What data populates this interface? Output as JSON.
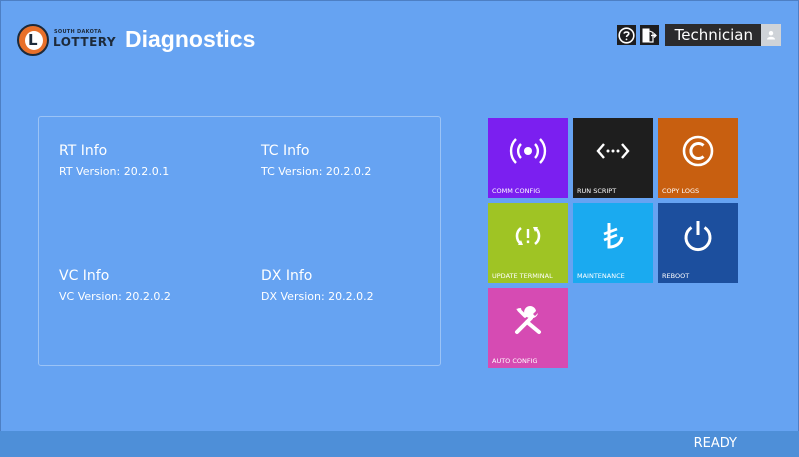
{
  "header": {
    "logo_small_text": "SOUTH DAKOTA",
    "logo_big_text": "LOTTERY",
    "logo_letter": "L",
    "title": "Diagnostics",
    "help_icon": "question-circle-icon",
    "logout_icon": "exit-door-icon",
    "user_name": "Technician",
    "user_icon": "user-icon"
  },
  "info": [
    {
      "title": "RT Info",
      "version": "RT Version: 20.2.0.1"
    },
    {
      "title": "TC Info",
      "version": "TC Version: 20.2.0.2"
    },
    {
      "title": "VC Info",
      "version": "VC Version: 20.2.0.2"
    },
    {
      "title": "DX Info",
      "version": "DX Version: 20.2.0.2"
    }
  ],
  "tiles": [
    {
      "label": "COMM CONFIG",
      "icon": "broadcast-icon",
      "color": "#7b1ff0"
    },
    {
      "label": "RUN SCRIPT",
      "icon": "code-arrows-icon",
      "color": "#1e1e1e"
    },
    {
      "label": "COPY LOGS",
      "icon": "copyright-icon",
      "color": "#c85f10"
    },
    {
      "label": "UPDATE TERMINAL",
      "icon": "sync-icon",
      "color": "#9fc424"
    },
    {
      "label": "MAINTENANCE",
      "icon": "lira-icon",
      "color": "#1aaaf0"
    },
    {
      "label": "REBOOT",
      "icon": "power-icon",
      "color": "#1c4f9e"
    },
    {
      "label": "AUTO CONFIG",
      "icon": "tools-icon",
      "color": "#d64bb3"
    }
  ],
  "status": {
    "text": "READY"
  },
  "colors": {
    "background": "#66a3f2",
    "statusbar": "#4e8fd8",
    "logo_orange": "#e8702a"
  }
}
